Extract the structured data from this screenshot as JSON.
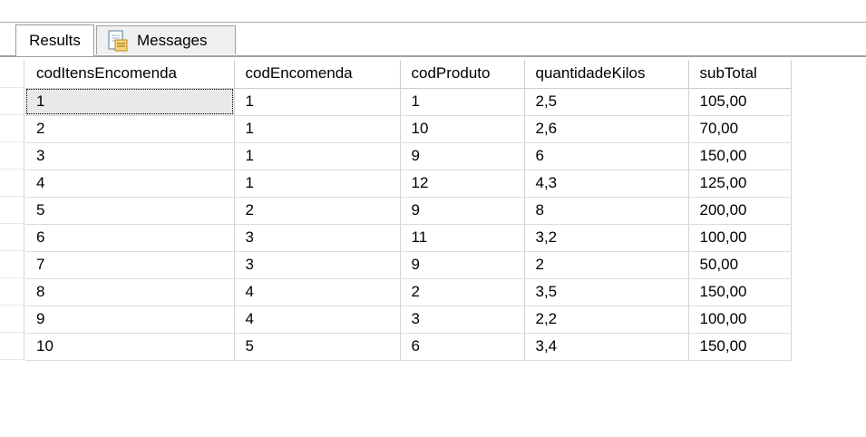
{
  "tabs": {
    "results_label": "Results",
    "messages_label": "Messages"
  },
  "icons": {
    "messages_tab_icon": "document-icon"
  },
  "grid": {
    "columns": [
      "codItensEncomenda",
      "codEncomenda",
      "codProduto",
      "quantidadeKilos",
      "subTotal"
    ],
    "rows": [
      [
        "1",
        "1",
        "1",
        "2,5",
        "105,00"
      ],
      [
        "2",
        "1",
        "10",
        "2,6",
        "70,00"
      ],
      [
        "3",
        "1",
        "9",
        "6",
        "150,00"
      ],
      [
        "4",
        "1",
        "12",
        "4,3",
        "125,00"
      ],
      [
        "5",
        "2",
        "9",
        "8",
        "200,00"
      ],
      [
        "6",
        "3",
        "11",
        "3,2",
        "100,00"
      ],
      [
        "7",
        "3",
        "9",
        "2",
        "50,00"
      ],
      [
        "8",
        "4",
        "2",
        "3,5",
        "150,00"
      ],
      [
        "9",
        "4",
        "3",
        "2,2",
        "100,00"
      ],
      [
        "10",
        "5",
        "6",
        "3,4",
        "150,00"
      ]
    ],
    "selected_cell": "1"
  }
}
